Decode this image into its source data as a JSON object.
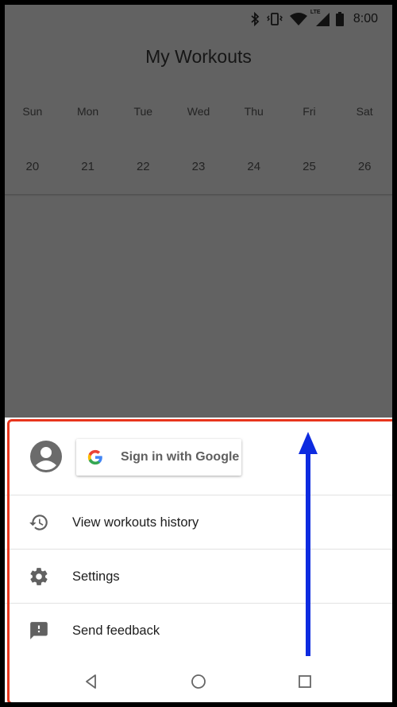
{
  "status_bar": {
    "time": "8:00",
    "network": "LTE"
  },
  "app": {
    "title": "My Workouts"
  },
  "calendar": {
    "day_names": [
      "Sun",
      "Mon",
      "Tue",
      "Wed",
      "Thu",
      "Fri",
      "Sat"
    ],
    "day_numbers": [
      "20",
      "21",
      "22",
      "23",
      "24",
      "25",
      "26"
    ]
  },
  "sheet": {
    "sign_in_label": "Sign in with Google",
    "menu": [
      {
        "label": "View workouts history",
        "icon": "history-icon"
      },
      {
        "label": "Settings",
        "icon": "gear-icon"
      },
      {
        "label": "Send feedback",
        "icon": "feedback-icon"
      }
    ]
  },
  "nav": {
    "buttons": [
      "back-icon",
      "home-icon",
      "recents-icon"
    ]
  },
  "colors": {
    "dim_overlay": "#626262",
    "sheet_background": "#ffffff",
    "highlight_outline": "#e8351c",
    "swipe_arrow": "#0d2be0",
    "icon_gray": "#616161"
  }
}
